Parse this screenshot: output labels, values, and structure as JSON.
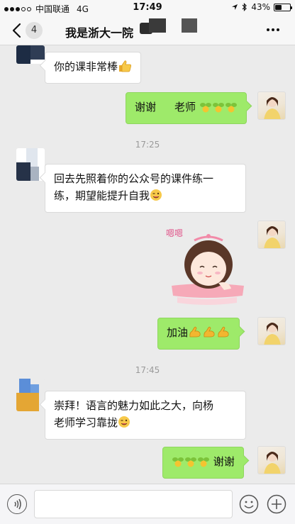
{
  "status_bar": {
    "carrier": "中国联通",
    "network": "4G",
    "time": "17:49",
    "battery_percent": "43%",
    "battery_level": 0.43
  },
  "nav": {
    "unread_count": "4",
    "title": "我是浙大一院"
  },
  "messages": [
    {
      "side": "in",
      "text": "你的课非常棒"
    },
    {
      "side": "out",
      "text_a": "谢谢",
      "text_b": "老师"
    },
    {
      "side": "time",
      "text": "17:25"
    },
    {
      "side": "in",
      "line1": "回去先照着你的公众号的课件练一",
      "line2": "练，期望能提升自我"
    },
    {
      "side": "out",
      "text": "加油"
    },
    {
      "side": "time",
      "text": "17:45"
    },
    {
      "side": "in",
      "line1": "崇拜！语言的魅力如此之大，向杨",
      "line2": "老师学习靠拢"
    },
    {
      "side": "out",
      "text": "谢谢"
    }
  ],
  "sticker": {
    "text": "嗯嗯",
    "icon": "cartoon-girl-sticker"
  },
  "input": {
    "placeholder": ""
  },
  "colors": {
    "outgoing_bubble": "#9eea6a",
    "incoming_bubble": "#ffffff",
    "chat_background": "#ebebeb"
  },
  "icons": {
    "thumbs_up": "thumbs-up-icon",
    "sprout": "sprout-icon",
    "wink": "wink-icon",
    "muscle": "muscle-icon"
  }
}
